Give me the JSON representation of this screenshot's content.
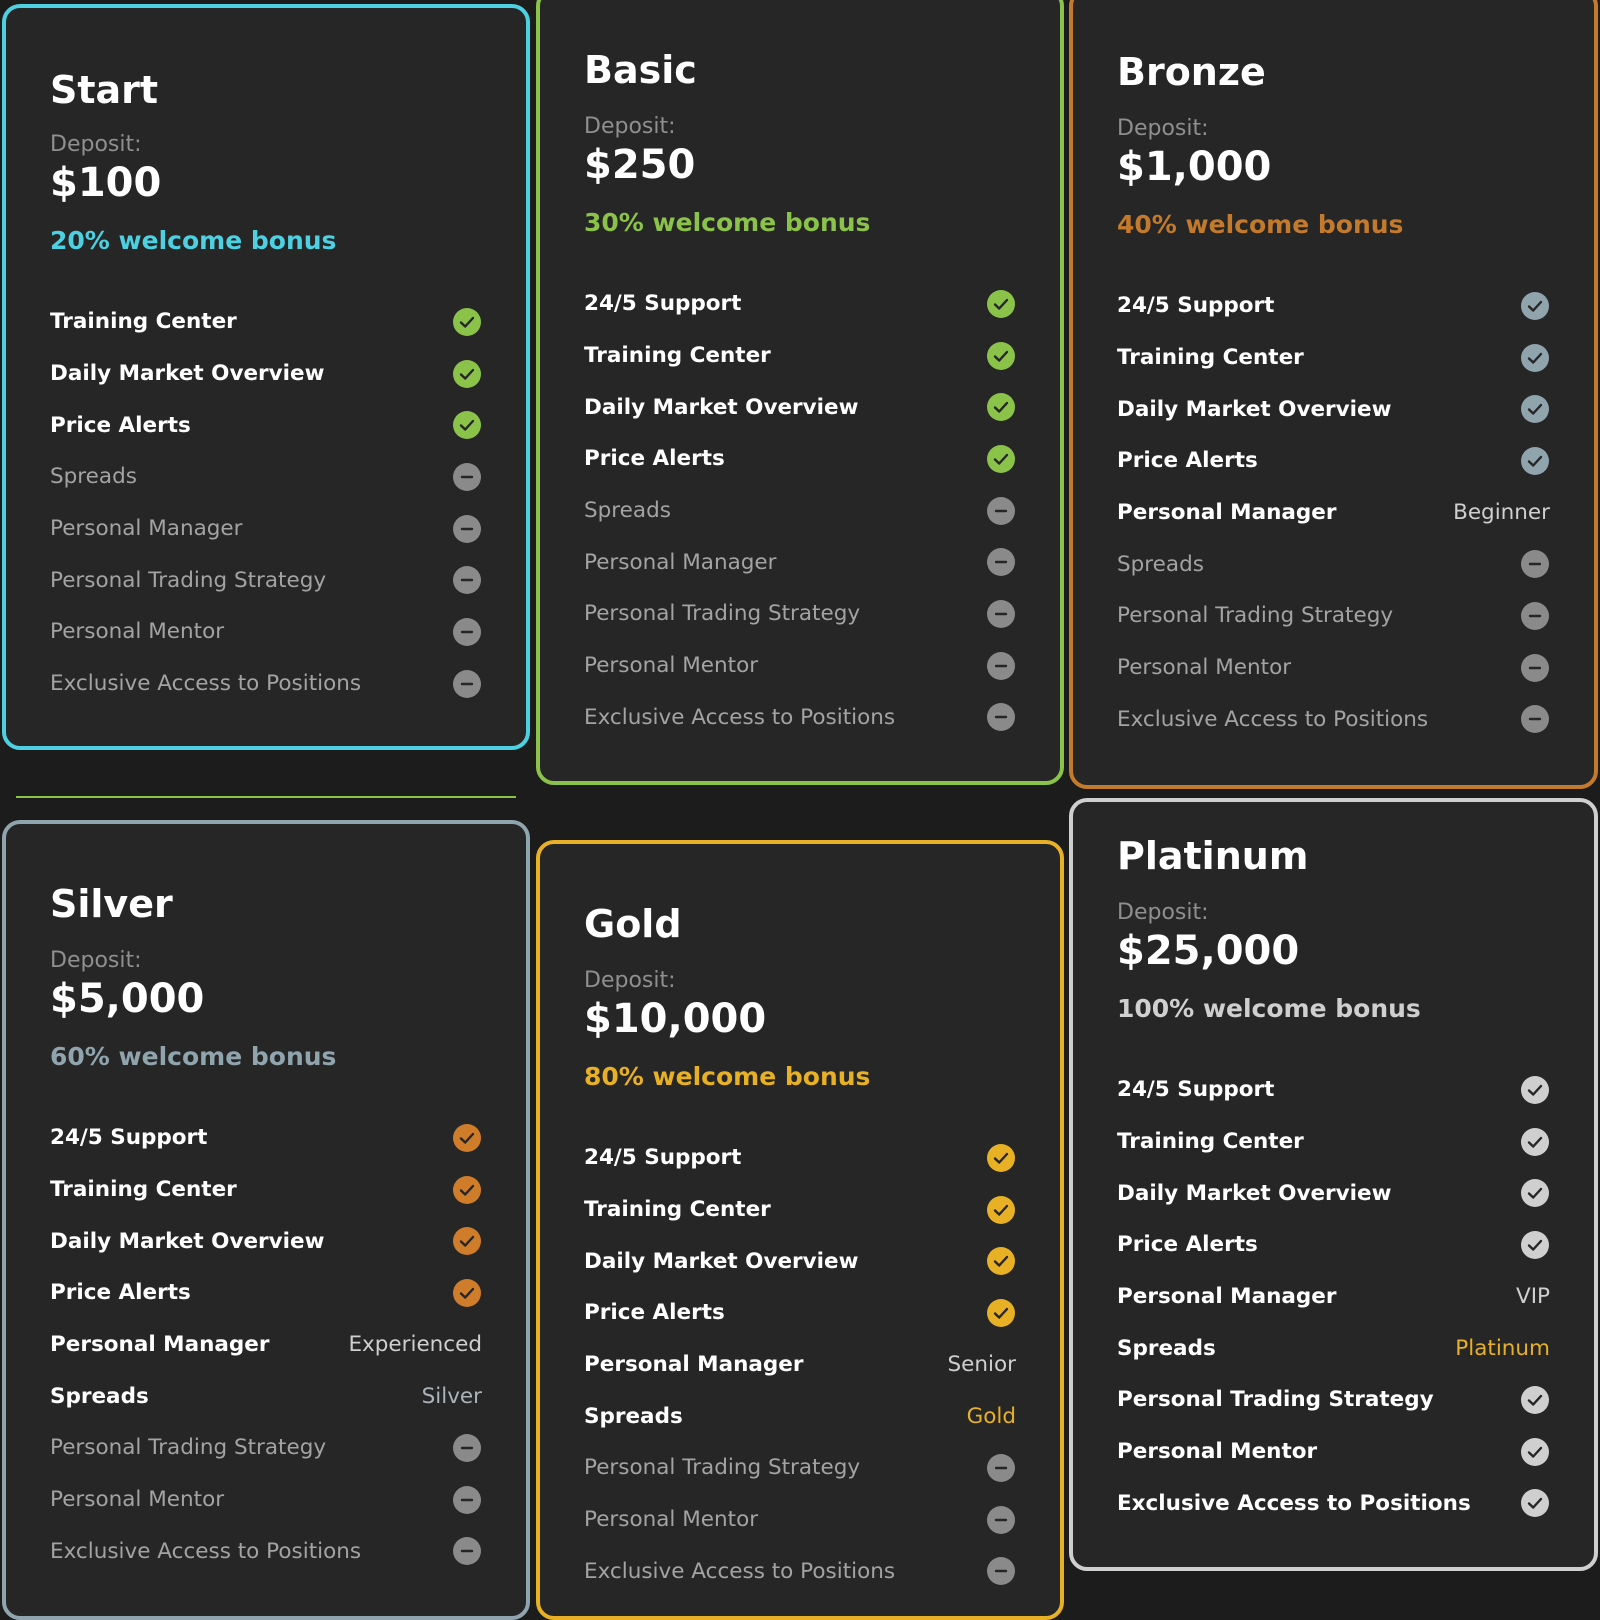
{
  "plans": [
    {
      "name": "Start",
      "deposit_label": "Deposit:",
      "deposit": "$100",
      "bonus": "20% welcome bonus",
      "accent": "#4dd0e1",
      "check_color": "#8bc34a",
      "features": [
        {
          "label": "Training Center",
          "status": "check"
        },
        {
          "label": "Daily Market Overview",
          "status": "check"
        },
        {
          "label": "Price Alerts",
          "status": "check"
        },
        {
          "label": "Spreads",
          "status": "none"
        },
        {
          "label": "Personal Manager",
          "status": "none"
        },
        {
          "label": "Personal Trading Strategy",
          "status": "none"
        },
        {
          "label": "Personal Mentor",
          "status": "none"
        },
        {
          "label": "Exclusive Access to Positions",
          "status": "none"
        }
      ]
    },
    {
      "name": "Basic",
      "deposit_label": "Deposit:",
      "deposit": "$250",
      "bonus": "30% welcome bonus",
      "accent": "#8bc34a",
      "check_color": "#8bc34a",
      "features": [
        {
          "label": "24/5 Support",
          "status": "check"
        },
        {
          "label": "Training Center",
          "status": "check"
        },
        {
          "label": "Daily Market Overview",
          "status": "check"
        },
        {
          "label": "Price Alerts",
          "status": "check"
        },
        {
          "label": "Spreads",
          "status": "none"
        },
        {
          "label": "Personal Manager",
          "status": "none"
        },
        {
          "label": "Personal Trading Strategy",
          "status": "none"
        },
        {
          "label": "Personal Mentor",
          "status": "none"
        },
        {
          "label": "Exclusive Access to Positions",
          "status": "none"
        }
      ]
    },
    {
      "name": "Bronze",
      "deposit_label": "Deposit:",
      "deposit": "$1,000",
      "bonus": "40% welcome bonus",
      "accent": "#c47a2c",
      "check_color": "#90a4ae",
      "features": [
        {
          "label": "24/5 Support",
          "status": "check"
        },
        {
          "label": "Training Center",
          "status": "check"
        },
        {
          "label": "Daily Market Overview",
          "status": "check"
        },
        {
          "label": "Price Alerts",
          "status": "check"
        },
        {
          "label": "Personal Manager",
          "status": "value",
          "value": "Beginner",
          "value_color": "#cfcfcf"
        },
        {
          "label": "Spreads",
          "status": "none"
        },
        {
          "label": "Personal Trading Strategy",
          "status": "none"
        },
        {
          "label": "Personal Mentor",
          "status": "none"
        },
        {
          "label": "Exclusive Access to Positions",
          "status": "none"
        }
      ]
    },
    {
      "name": "Silver",
      "deposit_label": "Deposit:",
      "deposit": "$5,000",
      "bonus": "60% welcome bonus",
      "accent": "#90a4ae",
      "check_color": "#d07d2b",
      "features": [
        {
          "label": "24/5 Support",
          "status": "check"
        },
        {
          "label": "Training Center",
          "status": "check"
        },
        {
          "label": "Daily Market Overview",
          "status": "check"
        },
        {
          "label": "Price Alerts",
          "status": "check"
        },
        {
          "label": "Personal Manager",
          "status": "value",
          "value": "Experienced",
          "value_color": "#cfcfcf"
        },
        {
          "label": "Spreads",
          "status": "value",
          "value": "Silver",
          "value_color": "#a9b4ba"
        },
        {
          "label": "Personal Trading Strategy",
          "status": "none"
        },
        {
          "label": "Personal Mentor",
          "status": "none"
        },
        {
          "label": "Exclusive Access to Positions",
          "status": "none"
        }
      ]
    },
    {
      "name": "Gold",
      "deposit_label": "Deposit:",
      "deposit": "$10,000",
      "bonus": "80% welcome bonus",
      "accent": "#e8b025",
      "check_color": "#e8b025",
      "features": [
        {
          "label": "24/5 Support",
          "status": "check"
        },
        {
          "label": "Training Center",
          "status": "check"
        },
        {
          "label": "Daily Market Overview",
          "status": "check"
        },
        {
          "label": "Price Alerts",
          "status": "check"
        },
        {
          "label": "Personal Manager",
          "status": "value",
          "value": "Senior",
          "value_color": "#cfcfcf"
        },
        {
          "label": "Spreads",
          "status": "value",
          "value": "Gold",
          "value_color": "#e8b025"
        },
        {
          "label": "Personal Trading Strategy",
          "status": "none"
        },
        {
          "label": "Personal Mentor",
          "status": "none"
        },
        {
          "label": "Exclusive Access to Positions",
          "status": "none"
        }
      ]
    },
    {
      "name": "Platinum",
      "deposit_label": "Deposit:",
      "deposit": "$25,000",
      "bonus": "100% welcome bonus",
      "accent": "#cfcfcf",
      "check_color": "#cfcfcf",
      "features": [
        {
          "label": "24/5 Support",
          "status": "check"
        },
        {
          "label": "Training Center",
          "status": "check"
        },
        {
          "label": "Daily Market Overview",
          "status": "check"
        },
        {
          "label": "Price Alerts",
          "status": "check"
        },
        {
          "label": "Personal Manager",
          "status": "value",
          "value": "VIP",
          "value_color": "#cfcfcf"
        },
        {
          "label": "Spreads",
          "status": "value",
          "value": "Platinum",
          "value_color": "#e8b025"
        },
        {
          "label": "Personal Trading Strategy",
          "status": "check"
        },
        {
          "label": "Personal Mentor",
          "status": "check"
        },
        {
          "label": "Exclusive Access to Positions",
          "status": "check"
        }
      ]
    }
  ],
  "colors": {
    "background": "#1c1c1c",
    "card": "#262626",
    "inactive_icon": "#8a8a8a",
    "inactive_text": "#a3a3a3"
  }
}
